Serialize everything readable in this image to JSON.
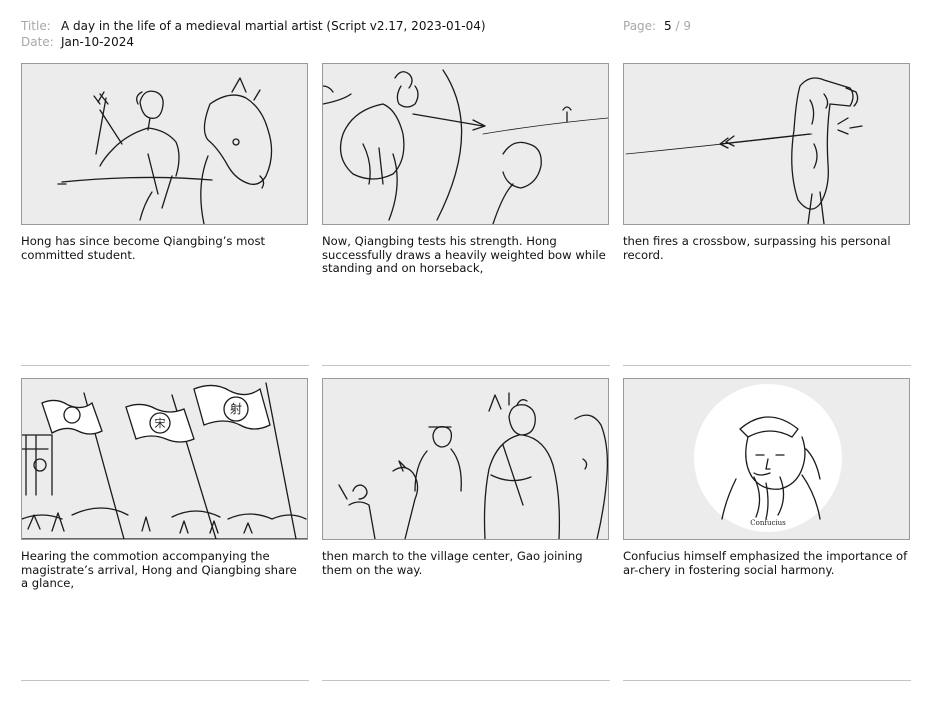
{
  "header": {
    "title_label": "Title:",
    "title": "A day in the life of a medieval martial artist (Script v2.17, 2023-01-04)",
    "date_label": "Date:",
    "date": "Jan-10-2024",
    "page_label": "Page:",
    "page_current": "5",
    "page_total": " / 9"
  },
  "panels": [
    {
      "shot_id": "P5-01",
      "caption": "Hong has since become Qiangbing’s most committed student."
    },
    {
      "shot_id": "P5-02",
      "caption": "Now, Qiangbing tests his strength. Hong successfully draws a heavily weighted bow while standing and on horseback,"
    },
    {
      "shot_id": "P5-03",
      "caption": "then fires a crossbow, surpassing his personal record."
    },
    {
      "shot_id": "P5-04",
      "caption": "Hearing the commotion accompanying the magistrate’s arrival, Hong and Qiangbing share a glance,"
    },
    {
      "shot_id": "P5-05",
      "caption": "then march to the village center, Gao joining them on the way."
    },
    {
      "shot_id": "P5-06",
      "caption": "Confucius himself emphasized the importance of ar-chery in fostering social harmony.",
      "sketch_label": "Confucius"
    }
  ],
  "banner_glyphs": [
    "宋",
    "射"
  ]
}
